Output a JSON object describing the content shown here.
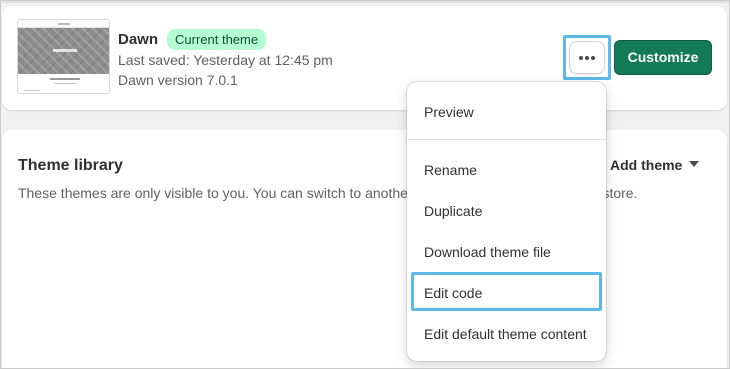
{
  "current_theme": {
    "name": "Dawn",
    "badge": "Current theme",
    "last_saved": "Last saved: Yesterday at 12:45 pm",
    "version": "Dawn version 7.0.1",
    "badge_color": "#b4fed2",
    "customize_label": "Customize",
    "primary_color": "#147a57",
    "actions_icon": "ellipsis-horizontal-icon"
  },
  "theme_library": {
    "title": "Theme library",
    "description": "These themes are only visible to you. You can switch to another theme by publishing it to your store.",
    "add_theme_label": "Add theme",
    "add_theme_icon": "caret-down-icon"
  },
  "actions_menu": {
    "items": [
      {
        "label": "Preview"
      },
      {
        "label": "Rename"
      },
      {
        "label": "Duplicate"
      },
      {
        "label": "Download theme file"
      },
      {
        "label": "Edit code",
        "highlighted": true
      },
      {
        "label": "Edit default theme content"
      }
    ],
    "highlight_color": "#5cb9ea"
  }
}
